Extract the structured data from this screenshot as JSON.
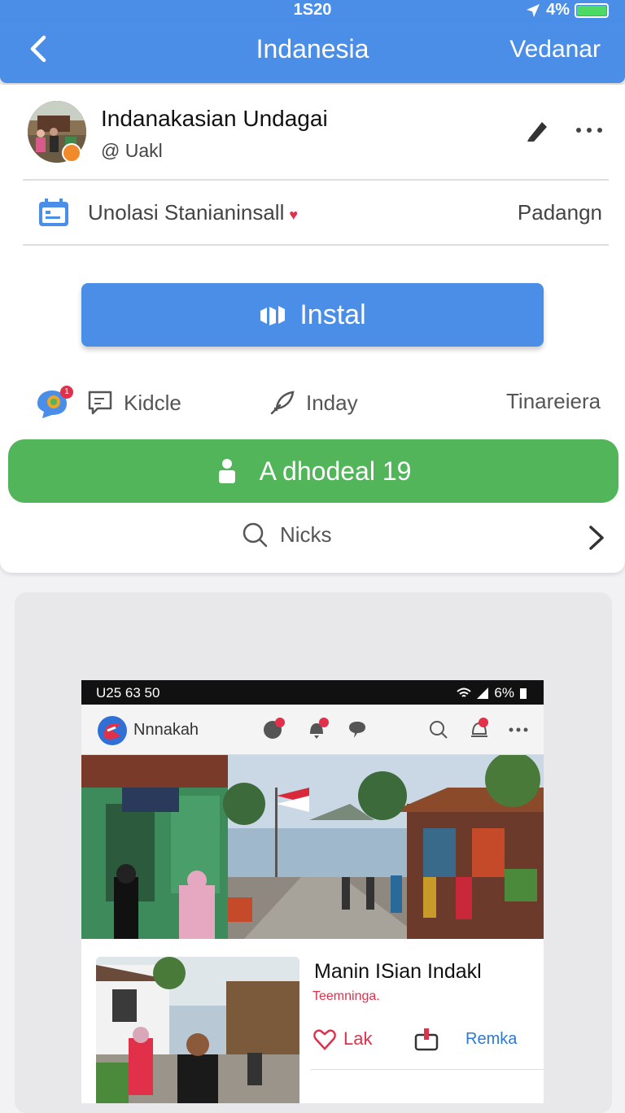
{
  "status_bar": {
    "time": "1S20",
    "battery": "4%",
    "phone_time": "U25 63 50",
    "phone_battery": "6%"
  },
  "navbar": {
    "title": "Indanesia",
    "action_label": "Vedanar",
    "back_icon": "chevron-left-icon"
  },
  "profile": {
    "name": "Indanakasian Undagai",
    "handle": "@ Uakl",
    "edit_icon": "pen-icon",
    "more_icon": "more-horizontal-icon"
  },
  "info_row": {
    "label": "Unolasi Stanianinsall",
    "heart": "♥",
    "right_text": "Padangn",
    "icon": "calendar-icon"
  },
  "install_button": {
    "label": "Instal",
    "icon": "install-icon"
  },
  "actions": [
    {
      "label": "Kidcle",
      "icon": "message-square-icon"
    },
    {
      "label": "Inday",
      "icon": "pencil-feather-icon"
    },
    {
      "label": "Tinareiera"
    }
  ],
  "chat_badge": "1",
  "green_button": {
    "label": "A dhodeal 19",
    "icon": "user-icon"
  },
  "search_row": {
    "label": "Nicks",
    "icon": "search-icon"
  },
  "preview": {
    "app_name": "Nnnakah",
    "card_title": "Manin ISian Indakl",
    "card_subtitle": "Teemninga.",
    "like_label": "Lak",
    "remka_label": "Remka"
  },
  "colors": {
    "primary": "#4a8ee8",
    "green": "#52b55a",
    "accent_red": "#e0304a",
    "battery": "#4cd964"
  }
}
